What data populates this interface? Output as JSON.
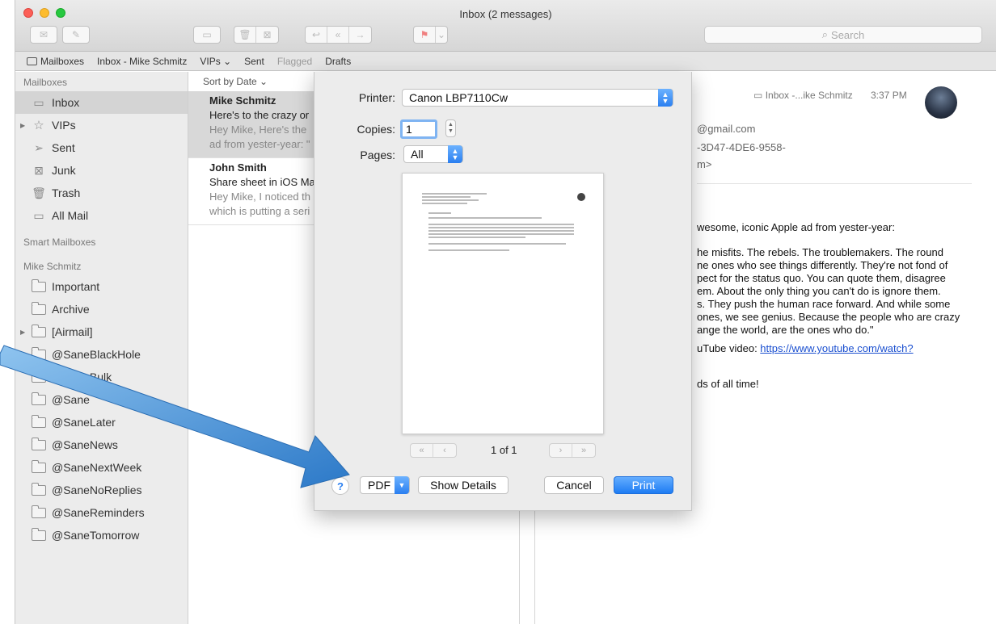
{
  "window": {
    "title": "Inbox (2 messages)"
  },
  "toolbar": {
    "search_placeholder": "Search"
  },
  "favorites": {
    "mailboxes": "Mailboxes",
    "inbox": "Inbox - Mike Schmitz",
    "vips": "VIPs",
    "sent": "Sent",
    "flagged": "Flagged",
    "drafts": "Drafts"
  },
  "sidebar": {
    "section_mailboxes": "Mailboxes",
    "inbox": "Inbox",
    "vips": "VIPs",
    "sent": "Sent",
    "junk": "Junk",
    "trash": "Trash",
    "all_mail": "All Mail",
    "section_smart": "Smart Mailboxes",
    "section_account": "Mike Schmitz",
    "folders": [
      "Important",
      "Archive",
      "[Airmail]",
      "@SaneBlackHole",
      "@SaneBulk",
      "@Sane",
      "@SaneLater",
      "@SaneNews",
      "@SaneNextWeek",
      "@SaneNoReplies",
      "@SaneReminders",
      "@SaneTomorrow"
    ]
  },
  "message_list": {
    "sort_label": "Sort by Date",
    "messages": [
      {
        "from": "Mike Schmitz",
        "subject": "Here's to the crazy or",
        "preview1": "Hey Mike, Here's the",
        "preview2": "ad from yester-year: \""
      },
      {
        "from": "John Smith",
        "subject": "Share sheet in iOS Ma",
        "preview1": "Hey Mike, I noticed th",
        "preview2": "which is putting a seri"
      }
    ]
  },
  "viewer": {
    "mailbox": "Inbox -...ike Schmitz",
    "time": "3:37 PM",
    "header_lines": [
      "@gmail.com",
      "-3D47-4DE6-9558-",
      "m>"
    ],
    "body_lines": [
      "wesome, iconic Apple ad from yester-year:",
      "he misfits. The rebels. The troublemakers. The round",
      "ne ones who see things differently. They're not fond of",
      "pect for the status quo. You can quote them, disagree",
      "em. About the only thing you can't do is ignore them.",
      "s. They push the human race forward. And while some",
      "ones, we see genius. Because the people who are crazy",
      "ange the world, are the ones who do.\""
    ],
    "link_prefix": "uTube video: ",
    "link_text": "https://www.youtube.com/watch?",
    "closing": "ds of all time!"
  },
  "print_sheet": {
    "printer_label": "Printer:",
    "printer_value": "Canon LBP7110Cw",
    "copies_label": "Copies:",
    "copies_value": "1",
    "pages_label": "Pages:",
    "pages_value": "All",
    "page_indicator": "1 of 1",
    "help": "?",
    "pdf": "PDF",
    "show_details": "Show Details",
    "cancel": "Cancel",
    "print": "Print"
  },
  "colors": {
    "accent": "#2a7ff0",
    "annotation_arrow": "#3f8fd6"
  }
}
